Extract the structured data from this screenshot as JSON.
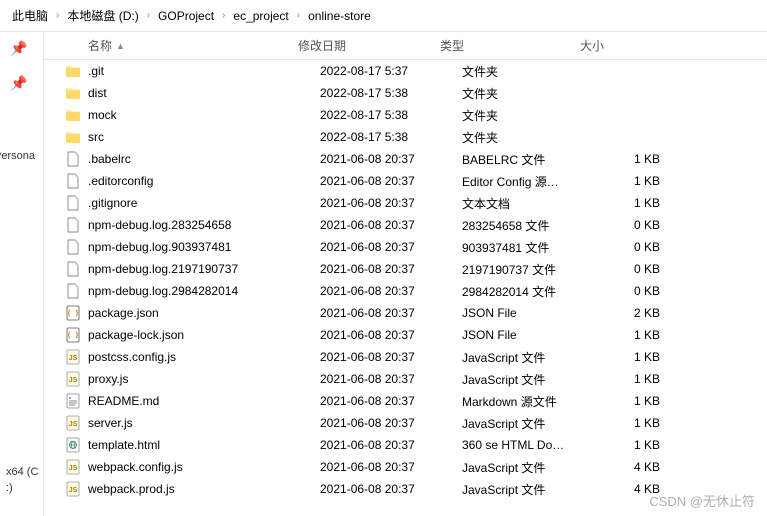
{
  "breadcrumb": [
    "此电脑",
    "本地磁盘 (D:)",
    "GOProject",
    "ec_project",
    "online-store"
  ],
  "columns": {
    "name": "名称",
    "date": "修改日期",
    "type": "类型",
    "size": "大小"
  },
  "sidebar": {
    "persona": "Persona",
    "drive1": "x64 (C",
    "drive2": ":)"
  },
  "files": [
    {
      "icon": "folder",
      "name": ".git",
      "date": "2022-08-17 5:37",
      "type": "文件夹",
      "size": ""
    },
    {
      "icon": "folder",
      "name": "dist",
      "date": "2022-08-17 5:38",
      "type": "文件夹",
      "size": ""
    },
    {
      "icon": "folder",
      "name": "mock",
      "date": "2022-08-17 5:38",
      "type": "文件夹",
      "size": ""
    },
    {
      "icon": "folder",
      "name": "src",
      "date": "2022-08-17 5:38",
      "type": "文件夹",
      "size": ""
    },
    {
      "icon": "file",
      "name": ".babelrc",
      "date": "2021-06-08 20:37",
      "type": "BABELRC 文件",
      "size": "1 KB"
    },
    {
      "icon": "file",
      "name": ".editorconfig",
      "date": "2021-06-08 20:37",
      "type": "Editor Config 源…",
      "size": "1 KB"
    },
    {
      "icon": "file",
      "name": ".gitignore",
      "date": "2021-06-08 20:37",
      "type": "文本文档",
      "size": "1 KB"
    },
    {
      "icon": "file",
      "name": "npm-debug.log.283254658",
      "date": "2021-06-08 20:37",
      "type": "283254658 文件",
      "size": "0 KB"
    },
    {
      "icon": "file",
      "name": "npm-debug.log.903937481",
      "date": "2021-06-08 20:37",
      "type": "903937481 文件",
      "size": "0 KB"
    },
    {
      "icon": "file",
      "name": "npm-debug.log.2197190737",
      "date": "2021-06-08 20:37",
      "type": "2197190737 文件",
      "size": "0 KB"
    },
    {
      "icon": "file",
      "name": "npm-debug.log.2984282014",
      "date": "2021-06-08 20:37",
      "type": "2984282014 文件",
      "size": "0 KB"
    },
    {
      "icon": "json",
      "name": "package.json",
      "date": "2021-06-08 20:37",
      "type": "JSON File",
      "size": "2 KB"
    },
    {
      "icon": "json",
      "name": "package-lock.json",
      "date": "2021-06-08 20:37",
      "type": "JSON File",
      "size": "1 KB"
    },
    {
      "icon": "js",
      "name": "postcss.config.js",
      "date": "2021-06-08 20:37",
      "type": "JavaScript 文件",
      "size": "1 KB"
    },
    {
      "icon": "js",
      "name": "proxy.js",
      "date": "2021-06-08 20:37",
      "type": "JavaScript 文件",
      "size": "1 KB"
    },
    {
      "icon": "md",
      "name": "README.md",
      "date": "2021-06-08 20:37",
      "type": "Markdown 源文件",
      "size": "1 KB"
    },
    {
      "icon": "js",
      "name": "server.js",
      "date": "2021-06-08 20:37",
      "type": "JavaScript 文件",
      "size": "1 KB"
    },
    {
      "icon": "html",
      "name": "template.html",
      "date": "2021-06-08 20:37",
      "type": "360 se HTML Do…",
      "size": "1 KB"
    },
    {
      "icon": "js",
      "name": "webpack.config.js",
      "date": "2021-06-08 20:37",
      "type": "JavaScript 文件",
      "size": "4 KB"
    },
    {
      "icon": "js",
      "name": "webpack.prod.js",
      "date": "2021-06-08 20:37",
      "type": "JavaScript 文件",
      "size": "4 KB"
    }
  ],
  "watermark": "CSDN @无休止符"
}
